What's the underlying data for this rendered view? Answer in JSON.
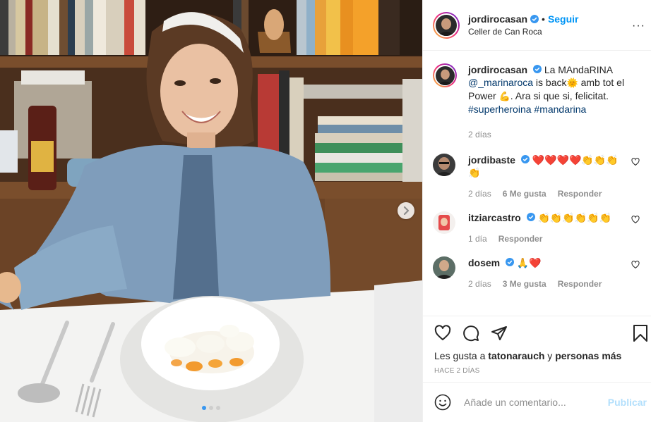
{
  "post": {
    "username": "jordirocasan",
    "follow_label": "Seguir",
    "separator": "•",
    "location": "Celler de Can Roca",
    "more_label": "···",
    "caption": {
      "username": "jordirocasan",
      "text_1": "La MAndaRINA",
      "mention": "@_marinaroca",
      "text_2": "is back",
      "emoji_1": "🌞",
      "text_3": "amb tot el Power",
      "emoji_2": "💪",
      "text_4": ". Ara si que si, felicitat.",
      "hashtag_1": "#superheroina",
      "hashtag_2": "#mandarina",
      "time": "2 días"
    },
    "comments": [
      {
        "username": "jordibaste",
        "text": "❤️❤️❤️❤️👏👏👏👏",
        "time": "2 días",
        "likes": "6 Me gusta",
        "reply": "Responder"
      },
      {
        "username": "itziarcastro",
        "text": "👏👏👏👏👏👏",
        "time": "1 día",
        "likes": "",
        "reply": "Responder"
      },
      {
        "username": "dosem",
        "text": "🙏❤️",
        "time": "2 días",
        "likes": "3 Me gusta",
        "reply": "Responder"
      }
    ],
    "likes": {
      "prefix": "Les gusta a",
      "user": "tatonarauch",
      "joiner": "y",
      "rest": "personas más"
    },
    "time_ago": "Hace 2 días",
    "add_comment": {
      "placeholder": "Añade un comentario...",
      "publish_label": "Publicar"
    },
    "carousel": {
      "count": 3,
      "active": 0
    }
  },
  "colors": {
    "accent": "#0095f6",
    "heart": "#ed4956",
    "verified": "#3897f0"
  }
}
